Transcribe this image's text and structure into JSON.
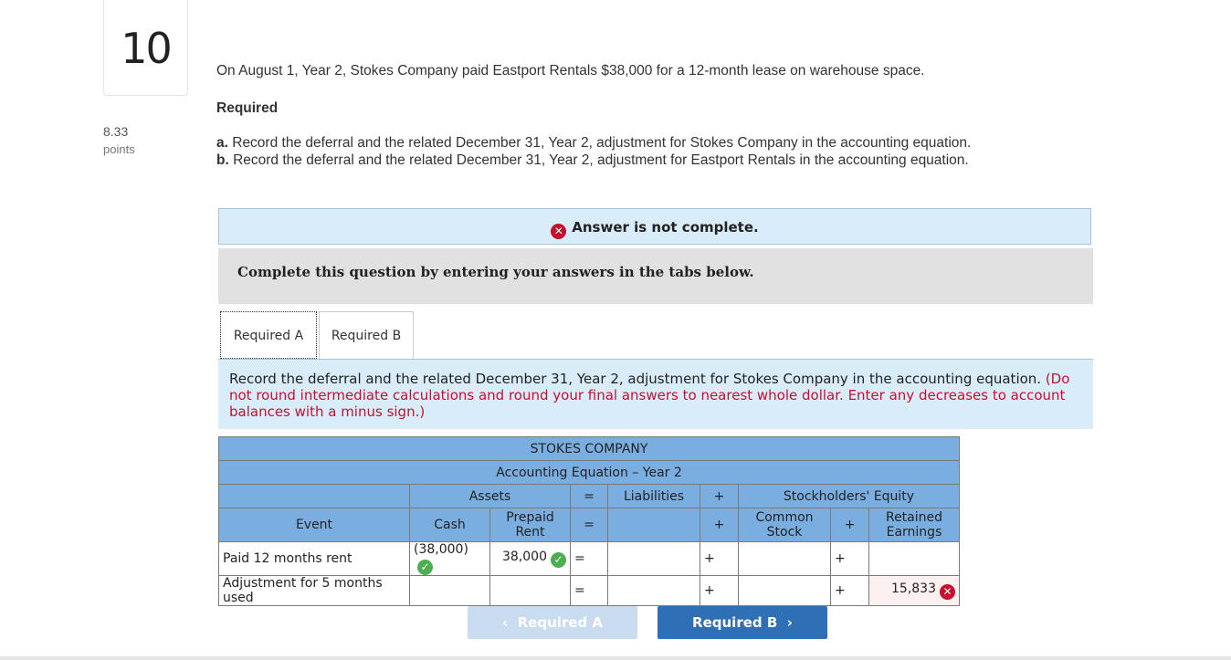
{
  "question": {
    "number": "10",
    "points_value": "8.33",
    "points_label": "points"
  },
  "prompt": "On August 1, Year 2, Stokes Company paid Eastport Rentals $38,000 for a 12-month lease on warehouse space.",
  "required_heading": "Required",
  "requirements": [
    {
      "letter": "a.",
      "text": " Record the deferral and the related December 31, Year 2, adjustment for Stokes Company in the accounting equation."
    },
    {
      "letter": "b.",
      "text": " Record the deferral and the related December 31, Year 2, adjustment for Eastport Rentals in the accounting equation."
    }
  ],
  "banner": {
    "text": "Answer is not complete."
  },
  "panel_text": "Complete this question by entering your answers in the tabs below.",
  "tabs": [
    {
      "label": "Required A"
    },
    {
      "label": "Required B"
    }
  ],
  "instructions": {
    "main": "Record the deferral and the related December 31, Year 2, adjustment for Stokes Company in the accounting equation.",
    "note": " (Do not round intermediate calculations and round your final answers to nearest whole dollar. Enter any decreases to account balances with a minus sign.)"
  },
  "table": {
    "title": "STOKES COMPANY",
    "subtitle": "Accounting Equation – Year 2",
    "groups": {
      "assets": "Assets",
      "eq": "=",
      "liabilities": "Liabilities",
      "plus": "+",
      "equity": "Stockholders' Equity"
    },
    "columns": {
      "event": "Event",
      "cash": "Cash",
      "prepaid": "Prepaid Rent",
      "eq": "=",
      "plus1": "+",
      "common": "Common Stock",
      "plus2": "+",
      "retained": "Retained Earnings"
    },
    "rows": [
      {
        "event": "Paid 12 months rent",
        "cash": "(38,000)",
        "prepaid": "38,000",
        "eq": "=",
        "liabilities": "",
        "plus1": "+",
        "common": "",
        "plus2": "+",
        "retained": ""
      },
      {
        "event": "Adjustment for 5 months used",
        "cash": "",
        "prepaid": "",
        "eq": "=",
        "liabilities": "",
        "plus1": "+",
        "common": "",
        "plus2": "+",
        "retained": "15,833"
      }
    ]
  },
  "nav": {
    "prev": "Required A",
    "next": "Required B"
  },
  "colors": {
    "header_blue": "#7aaee0",
    "banner_blue": "#d9ecf9",
    "error_red": "#c8102e",
    "check_green": "#4caf50",
    "next_blue": "#2f6fb5"
  }
}
